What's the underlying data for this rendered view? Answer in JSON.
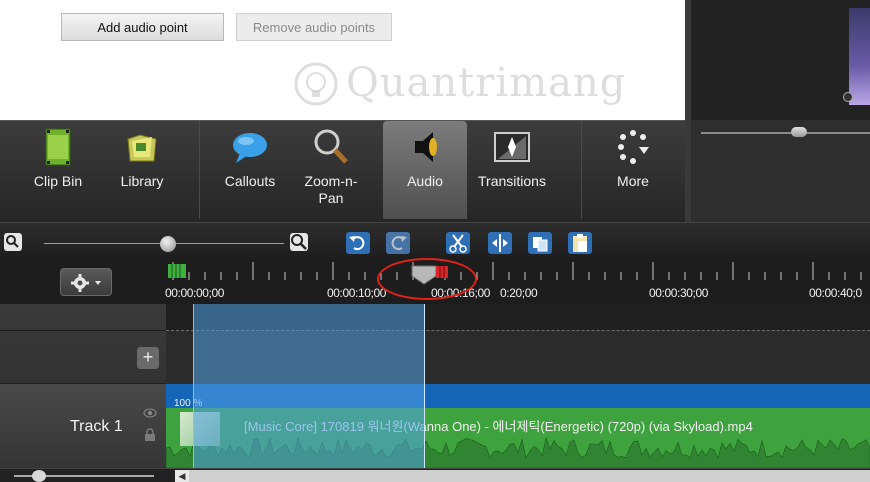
{
  "audio_panel": {
    "add_audio_point_label": "Add audio point",
    "remove_audio_points_label": "Remove audio points",
    "watermark": "Quantrimang"
  },
  "tasks": [
    {
      "label": "Clip Bin",
      "icon": "clip-bin-icon"
    },
    {
      "label": "Library",
      "icon": "library-icon"
    },
    {
      "label": "Callouts",
      "icon": "callouts-icon"
    },
    {
      "label": "Zoom-n-Pan",
      "icon": "zoom-n-pan-icon"
    },
    {
      "label": "Audio",
      "icon": "audio-icon",
      "active": true
    },
    {
      "label": "Transitions",
      "icon": "transitions-icon"
    },
    {
      "label": "More",
      "icon": "more-icon"
    }
  ],
  "toolbar": {
    "icons": [
      "zoom-out-icon",
      "zoom-in-icon",
      "undo-icon",
      "redo-icon",
      "cut-icon",
      "split-icon",
      "copy-icon",
      "paste-icon"
    ],
    "zoom_level": 0.6
  },
  "ruler": {
    "time_labels": [
      "00:00:00;00",
      "00:00:10;00",
      "00:00:16;00",
      "0:20;00",
      "00:00:30;00",
      "00:00:40;0"
    ],
    "playhead": "00:00:16;00"
  },
  "tracks": {
    "track1_label": "Track 1",
    "clip_title": "[Music Core] 170819 워너원(Wanna One) - 에너제틱(Energetic) (720p) (via Skyload).mp4",
    "volume_label": "100 %"
  },
  "colors": {
    "clip_green": "#3ea23e",
    "clip_blue": "#1565b8",
    "selection": "#50a0e6",
    "highlight_circle": "#e0211a"
  }
}
